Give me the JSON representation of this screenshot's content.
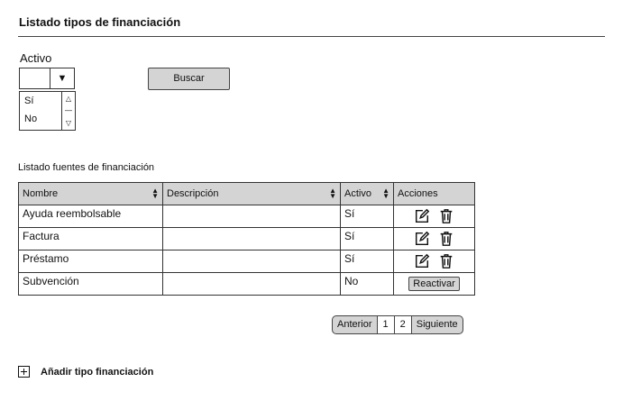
{
  "page": {
    "title": "Listado tipos de financiación"
  },
  "filter": {
    "label": "Activo",
    "selected": "",
    "dropdown_icon": "triangle-down-icon",
    "options": [
      "Sí",
      "No"
    ],
    "search_label": "Buscar"
  },
  "table": {
    "title": "Listado fuentes de financiación",
    "columns": [
      "Nombre",
      "Descripción",
      "Activo",
      "Acciones"
    ],
    "rows": [
      {
        "nombre": "Ayuda reembolsable",
        "descripcion": "",
        "activo": "Sí",
        "action": "edit-delete"
      },
      {
        "nombre": "Factura",
        "descripcion": "",
        "activo": "Sí",
        "action": "edit-delete"
      },
      {
        "nombre": "Préstamo",
        "descripcion": "",
        "activo": "Sí",
        "action": "edit-delete"
      },
      {
        "nombre": "Subvención",
        "descripcion": "",
        "activo": "No",
        "action": "reactivate"
      }
    ],
    "reactivate_label": "Reactivar"
  },
  "pagination": {
    "prev": "Anterior",
    "pages": [
      "1",
      "2"
    ],
    "next": "Siguiente"
  },
  "add": {
    "label": "Añadir tipo financiación",
    "icon": "plus-box-icon"
  }
}
